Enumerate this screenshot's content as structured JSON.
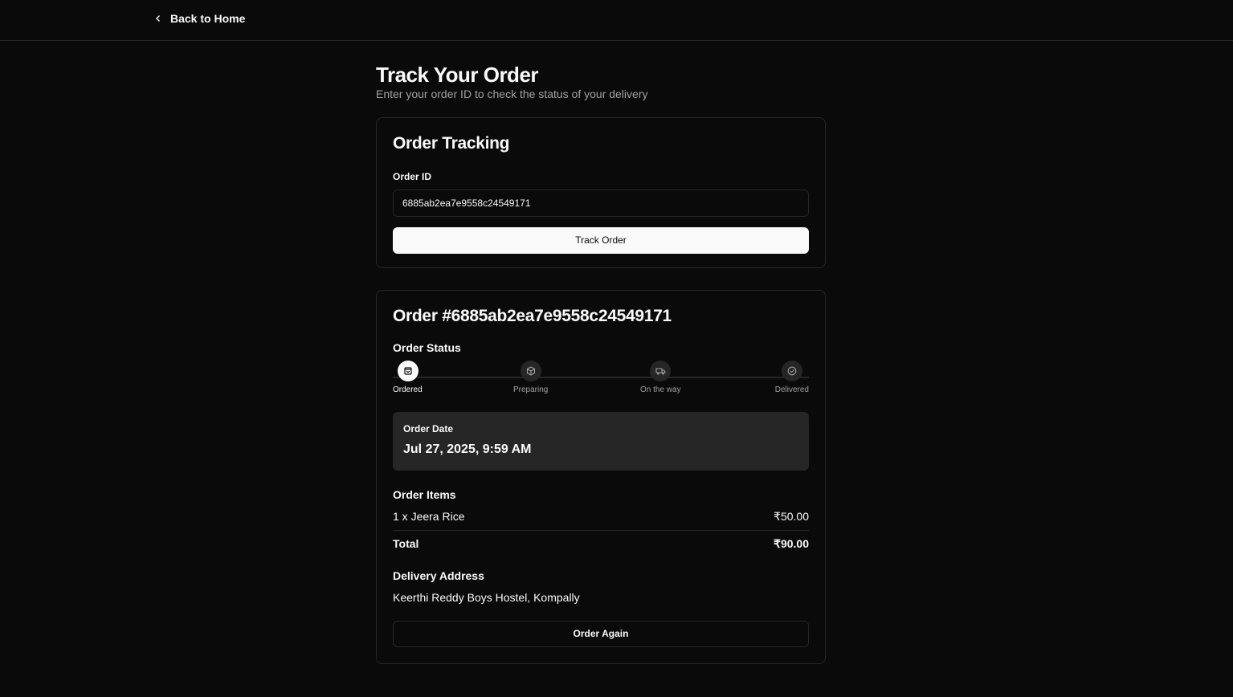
{
  "header": {
    "back_label": "Back to Home"
  },
  "page": {
    "title": "Track Your Order",
    "subtitle": "Enter your order ID to check the status of your delivery"
  },
  "tracking": {
    "title": "Order Tracking",
    "order_id_label": "Order ID",
    "order_id_value": "6885ab2ea7e9558c24549171",
    "track_button": "Track Order"
  },
  "order": {
    "title": "Order #6885ab2ea7e9558c24549171",
    "status_label": "Order Status",
    "steps": [
      {
        "label": "Ordered",
        "icon": "shopping-bag-icon",
        "active": true
      },
      {
        "label": "Preparing",
        "icon": "package-icon",
        "active": false
      },
      {
        "label": "On the way",
        "icon": "truck-icon",
        "active": false
      },
      {
        "label": "Delivered",
        "icon": "check-circle-icon",
        "active": false
      }
    ],
    "date_label": "Order Date",
    "date_value": "Jul 27, 2025, 9:59 AM",
    "items_label": "Order Items",
    "items": [
      {
        "name": "1 x Jeera Rice",
        "price": "₹50.00"
      }
    ],
    "total_label": "Total",
    "total_value": "₹90.00",
    "address_label": "Delivery Address",
    "address_value": "Keerthi Reddy Boys Hostel, Kompally",
    "order_again": "Order Again"
  }
}
